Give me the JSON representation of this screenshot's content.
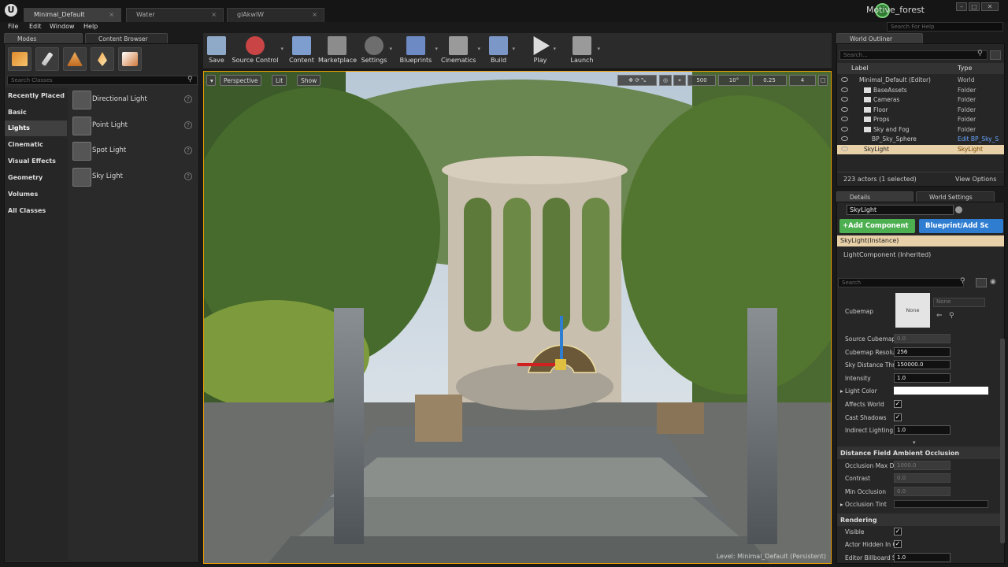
{
  "window": {
    "project": "Motive_forest",
    "tabs": [
      "Minimal_Default",
      "Water",
      "glAkwlW"
    ],
    "search_help_placeholder": "Search For Help"
  },
  "menu": [
    "File",
    "Edit",
    "Window",
    "Help"
  ],
  "modes_panel": {
    "tab_modes": "Modes",
    "tab_content": "Content Browser",
    "search_placeholder": "Search Classes",
    "categories": [
      "Recently Placed",
      "Basic",
      "Lights",
      "Cinematic",
      "Visual Effects",
      "Geometry",
      "Volumes",
      "All Classes"
    ],
    "selected_category": "Lights",
    "items": [
      "Directional Light",
      "Point Light",
      "Spot Light",
      "Sky Light"
    ]
  },
  "toolbar": [
    "Save",
    "Source Control",
    "Content",
    "Marketplace",
    "Settings",
    "Blueprints",
    "Cinematics",
    "Build",
    "Play",
    "Launch"
  ],
  "viewport": {
    "perspective": "Perspective",
    "lit": "Lit",
    "show": "Show",
    "grid": "500",
    "angle": "10°",
    "scale": "0.25",
    "cam": "4",
    "level": "Level:  Minimal_Default (Persistent)"
  },
  "outliner": {
    "tab": "World Outliner",
    "search_placeholder": "Search...",
    "col_label": "Label",
    "col_type": "Type",
    "rows": [
      {
        "label": "Minimal_Default (Editor)",
        "type": "World"
      },
      {
        "label": "BaseAssets",
        "type": "Folder"
      },
      {
        "label": "Cameras",
        "type": "Folder"
      },
      {
        "label": "Floor",
        "type": "Folder"
      },
      {
        "label": "Props",
        "type": "Folder"
      },
      {
        "label": "Sky and Fog",
        "type": "Folder"
      },
      {
        "label": "BP_Sky_Sphere",
        "type": "Edit BP_Sky_S"
      },
      {
        "label": "SkyLight",
        "type": "SkyLight"
      }
    ],
    "status": "223 actors (1 selected)",
    "view_options": "View Options"
  },
  "details": {
    "tab": "Details",
    "tab_world": "World Settings",
    "name": "SkyLight",
    "add_component": "+Add Component",
    "blueprint": "Blueprint/Add Sc",
    "instance": "SkyLight(Instance)",
    "component": "LightComponent (Inherited)",
    "search_placeholder": "Search",
    "cubemap_label": "Cubemap",
    "cubemap_none": "None",
    "cubemap_select": "None",
    "props": [
      {
        "label": "Source Cubemap",
        "value": "0.0",
        "dim": true
      },
      {
        "label": "Cubemap Resolut",
        "value": "256"
      },
      {
        "label": "Sky Distance Thr",
        "value": "150000.0"
      },
      {
        "label": "Intensity",
        "value": "1.0"
      }
    ],
    "light_color": "Light Color",
    "affects_world": "Affects World",
    "cast_shadows": "Cast Shadows",
    "indirect": "Indirect Lighting I",
    "indirect_value": "1.0",
    "dfao_section": "Distance Field Ambient Occlusion",
    "dfao": [
      {
        "label": "Occlusion Max Di",
        "value": "1000.0"
      },
      {
        "label": "Contrast",
        "value": "0.0"
      },
      {
        "label": "Min Occlusion",
        "value": "0.0"
      }
    ],
    "occlusion_tint": "Occlusion Tint",
    "rendering_section": "Rendering",
    "visible": "Visible",
    "actor_hidden": "Actor Hidden In G",
    "billboard": "Editor Billboard Sc",
    "billboard_value": "1.0"
  },
  "colors": {
    "accent_orange": "#f0a000",
    "green_button": "#4caf50",
    "blue_button": "#2f7dd1"
  }
}
